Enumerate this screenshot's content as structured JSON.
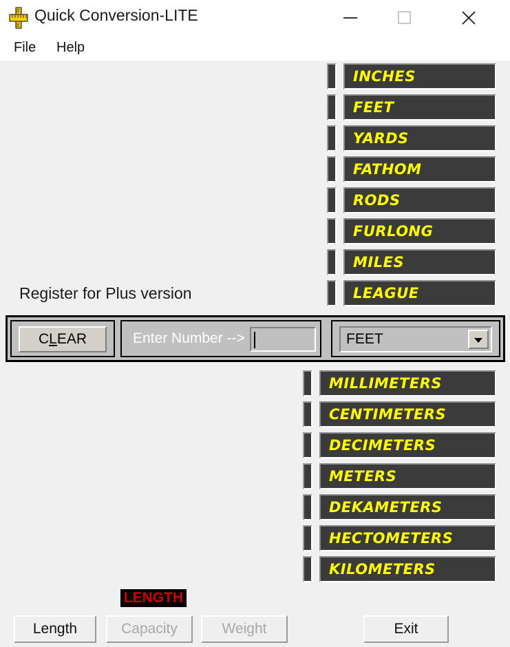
{
  "window": {
    "title": "Quick Conversion-LITE",
    "icon": "ruler-icon",
    "controls": {
      "minimize": "minimize-icon",
      "maximize": "maximize-icon",
      "close": "close-icon"
    }
  },
  "menu": {
    "items": [
      {
        "label": "File"
      },
      {
        "label": "Help"
      }
    ]
  },
  "imperial_units": [
    {
      "label": "INCHES",
      "value": ""
    },
    {
      "label": "FEET",
      "value": ""
    },
    {
      "label": "YARDS",
      "value": ""
    },
    {
      "label": "FATHOM",
      "value": ""
    },
    {
      "label": "RODS",
      "value": ""
    },
    {
      "label": "FURLONG",
      "value": ""
    },
    {
      "label": "MILES",
      "value": ""
    },
    {
      "label": "LEAGUE",
      "value": ""
    }
  ],
  "metric_units": [
    {
      "label": "MILLIMETERS",
      "value": ""
    },
    {
      "label": "CENTIMETERS",
      "value": ""
    },
    {
      "label": "DECIMETERS",
      "value": ""
    },
    {
      "label": "METERS",
      "value": ""
    },
    {
      "label": "DEKAMETERS",
      "value": ""
    },
    {
      "label": "HECTOMETERS",
      "value": ""
    },
    {
      "label": "KILOMETERS",
      "value": ""
    }
  ],
  "register_notice": "Register for Plus version",
  "controls": {
    "clear_label_pre": "C",
    "clear_label_accel": "L",
    "clear_label_post": "EAR",
    "enter_number_label": "Enter Number -->",
    "number_input_value": "",
    "number_input_placeholder": "",
    "unit_select_value": "FEET",
    "unit_select_options": [
      "INCHES",
      "FEET",
      "YARDS",
      "FATHOM",
      "RODS",
      "FURLONG",
      "MILES",
      "LEAGUE",
      "MILLIMETERS",
      "CENTIMETERS",
      "DECIMETERS",
      "METERS",
      "DEKAMETERS",
      "HECTOMETERS",
      "KILOMETERS"
    ]
  },
  "bottom": {
    "mode_badge": "LENGTH",
    "buttons": [
      {
        "label": "Length",
        "enabled": true
      },
      {
        "label": "Capacity",
        "enabled": false
      },
      {
        "label": "Weight",
        "enabled": false
      }
    ],
    "exit_label": "Exit"
  },
  "colors": {
    "display_bg": "#3b3b3b",
    "display_text": "#ffff00",
    "badge_bg": "#000000",
    "badge_text": "#cc0000",
    "window_bg": "#f0f0f0",
    "control_bar_bg": "#c0c0c0"
  }
}
